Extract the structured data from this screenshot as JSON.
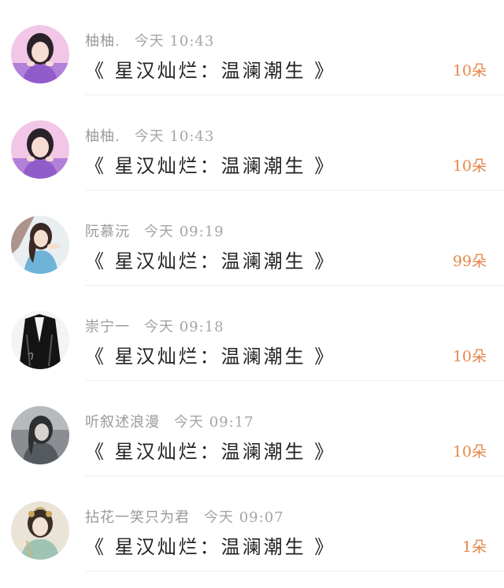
{
  "gifts": [
    {
      "user": "柚柚.",
      "time": "今天 10:43",
      "title": "《 星汉灿烂：温澜潮生 》",
      "amount": "10朵",
      "avatar": "girl-purple-avatar"
    },
    {
      "user": "柚柚.",
      "time": "今天 10:43",
      "title": "《 星汉灿烂：温澜潮生 》",
      "amount": "10朵",
      "avatar": "girl-purple-avatar"
    },
    {
      "user": "阮慕沅",
      "time": "今天 09:19",
      "title": "《 星汉灿烂：温澜潮生 》",
      "amount": "99朵",
      "avatar": "girl-blue-dress-avatar"
    },
    {
      "user": "崇宁一",
      "time": "今天 09:18",
      "title": "《 星汉灿烂：温澜潮生 》",
      "amount": "10朵",
      "avatar": "dark-robe-figure-avatar"
    },
    {
      "user": "听叙述浪漫",
      "time": "今天 09:17",
      "title": "《 星汉灿烂：温澜潮生 》",
      "amount": "10朵",
      "avatar": "grey-portrait-avatar"
    },
    {
      "user": "拈花一笑只为君",
      "time": "今天 09:07",
      "title": "《 星汉灿烂：温澜潮生 》",
      "amount": "1朵",
      "avatar": "ancient-costume-avatar"
    }
  ],
  "colors": {
    "amount": "#e5874a",
    "meta": "#9a9a9a",
    "title": "#222222"
  }
}
